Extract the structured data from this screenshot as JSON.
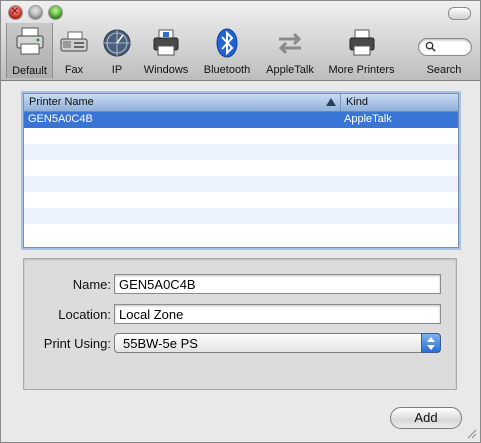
{
  "toolbar": {
    "items": [
      {
        "label": "Default",
        "icon": "printer-icon"
      },
      {
        "label": "Fax",
        "icon": "fax-icon"
      },
      {
        "label": "IP",
        "icon": "globe-icon"
      },
      {
        "label": "Windows",
        "icon": "windows-printer-icon"
      },
      {
        "label": "Bluetooth",
        "icon": "bluetooth-icon"
      },
      {
        "label": "AppleTalk",
        "icon": "appletalk-icon"
      },
      {
        "label": "More Printers",
        "icon": "printer-icon"
      },
      {
        "label": "Search",
        "icon": "search-icon"
      }
    ]
  },
  "list": {
    "columns": [
      "Printer Name",
      "Kind"
    ],
    "rows": [
      {
        "name": "GEN5A0C4B",
        "kind": "AppleTalk",
        "selected": true
      }
    ]
  },
  "form": {
    "name_label": "Name:",
    "name_value": "GEN5A0C4B",
    "location_label": "Location:",
    "location_value": "Local Zone",
    "print_using_label": "Print Using:",
    "print_using_value": "55BW-5e PS"
  },
  "buttons": {
    "add": "Add"
  },
  "colors": {
    "selection": "#3875d7",
    "alt_row": "#edf3fe"
  }
}
